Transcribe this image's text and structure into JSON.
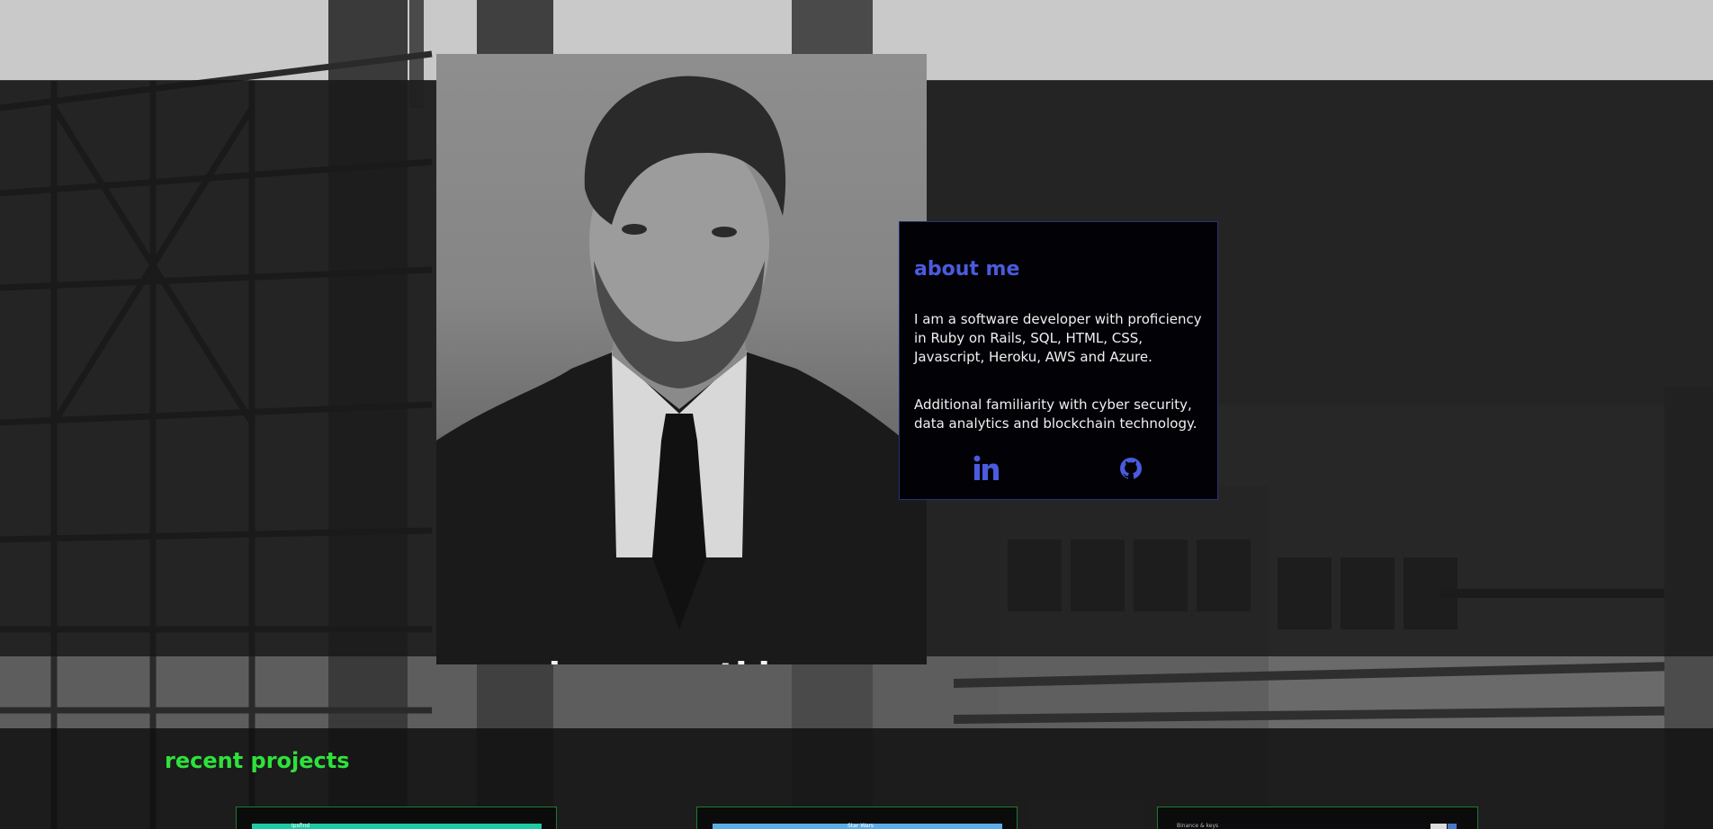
{
  "profile": {
    "name": "jason watkins",
    "photo_alt": "Portrait of jason watkins"
  },
  "about": {
    "title": "about me",
    "paragraph_1": "I am a software developer with proficiency in Ruby on Rails, SQL, HTML, CSS, Javascript, Heroku, AWS and Azure.",
    "paragraph_2": "Additional familiarity with cyber security, data analytics and blockchain technology.",
    "links": [
      {
        "label": "LinkedIn",
        "icon": "linkedin-icon"
      },
      {
        "label": "GitHub",
        "icon": "github-icon"
      }
    ]
  },
  "projects": {
    "title": "recent projects",
    "cards": [
      {
        "thumb_color": "#1ec9a3",
        "thumb_text_left": "Ipsfind",
        "thumb_text_right": ""
      },
      {
        "thumb_color": "#5aaee8",
        "thumb_text_left": "Star Wars",
        "thumb_text_right": ""
      },
      {
        "thumb_color": "#0c0c10",
        "thumb_text_left": "Binance & keys",
        "thumb_text_right": ""
      }
    ]
  },
  "colors": {
    "accent_blue": "#4a5bde",
    "accent_green": "#2ee23b",
    "card_border_green": "#1e7a2e"
  }
}
